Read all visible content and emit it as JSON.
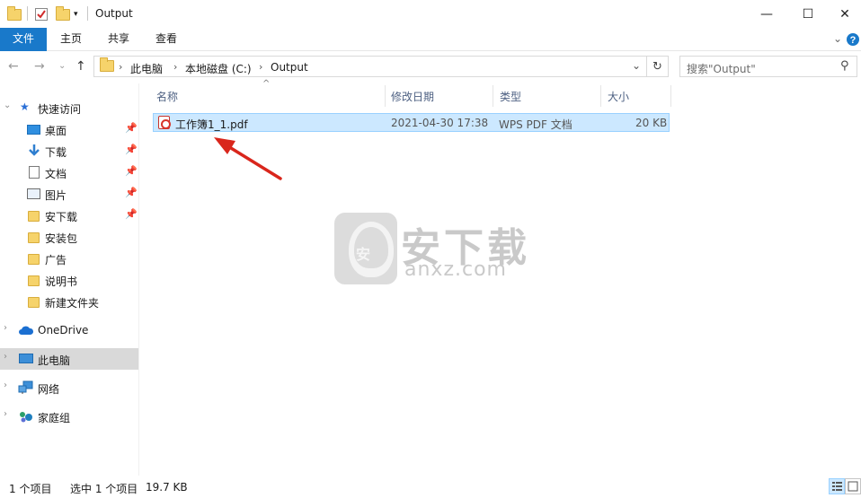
{
  "window": {
    "title": "Output",
    "minimize_glyph": "—",
    "maximize_glyph": "☐",
    "close_glyph": "✕",
    "help_glyph": "?",
    "ribbon_expand_glyph": "⌄"
  },
  "ribbon": {
    "tabs": [
      {
        "label": "文件"
      },
      {
        "label": "主页"
      },
      {
        "label": "共享"
      },
      {
        "label": "查看"
      }
    ]
  },
  "address": {
    "crumbs": [
      "此电脑",
      "本地磁盘 (C:)",
      "Output"
    ],
    "search_placeholder": "搜索\"Output\"",
    "back_glyph": "←",
    "forward_glyph": "→",
    "recent_glyph": "⌄",
    "up_glyph": "↑",
    "dropdown_glyph": "⌄",
    "refresh_glyph": "↻",
    "search_glyph": "⚲",
    "crumb_sep": "›"
  },
  "nav": {
    "quick_access": "快速访问",
    "items": [
      {
        "label": "桌面",
        "pinned": true
      },
      {
        "label": "下载",
        "pinned": true
      },
      {
        "label": "文档",
        "pinned": true
      },
      {
        "label": "图片",
        "pinned": true
      },
      {
        "label": "安下载",
        "pinned": true
      },
      {
        "label": "安装包",
        "pinned": false
      },
      {
        "label": "广告",
        "pinned": false
      },
      {
        "label": "说明书",
        "pinned": false
      },
      {
        "label": "新建文件夹",
        "pinned": false
      }
    ],
    "onedrive": "OneDrive",
    "this_pc": "此电脑",
    "network": "网络",
    "homegroup": "家庭组",
    "pin_glyph": "📌",
    "expand_glyph": "›",
    "collapse_glyph": "⌄",
    "star_glyph": "★"
  },
  "columns": {
    "name": "名称",
    "modified": "修改日期",
    "type": "类型",
    "size": "大小",
    "sort_glyph": "^"
  },
  "files": [
    {
      "name": "工作簿1_1.pdf",
      "modified": "2021-04-30 17:38",
      "type": "WPS PDF 文档",
      "size": "20 KB"
    }
  ],
  "status": {
    "item_count": "1 个项目",
    "selected": "选中 1 个项目",
    "selected_size": "19.7 KB"
  },
  "watermark": {
    "cn": "安下载",
    "en": "anxz.com",
    "inner": "安"
  },
  "colors": {
    "accent": "#1979ca",
    "selection": "#cce8ff",
    "arrow": "#d9261c"
  }
}
